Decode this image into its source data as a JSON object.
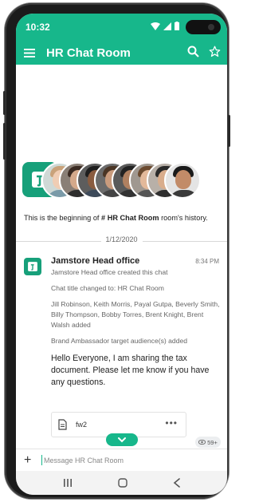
{
  "status_bar": {
    "time": "10:32"
  },
  "app_bar": {
    "title": "HR Chat Room"
  },
  "history": {
    "prefix": "This is the beginning of ",
    "room": "# HR Chat Room",
    "suffix": " room's history."
  },
  "date_divider": "1/12/2020",
  "message": {
    "sender": "Jamstore Head office",
    "time": "8:34 PM",
    "system_lines": [
      "Jamstore Head office created this chat",
      "Chat title changed to: HR Chat Room",
      "Jill Robinson, Keith Morris, Payal Gutpa, Beverly Smith, Billy Thompson, Bobby Torres, Brent Knight, Brent Walsh added",
      "Brand Ambassador target audience(s) added"
    ],
    "text": "Hello Everyone, I am sharing the tax document. Please let me know if you have any questions.",
    "attachment": {
      "name": "fw2",
      "menu": "•••"
    },
    "seen_count": "59+"
  },
  "composer": {
    "placeholder": "Message HR Chat Room"
  },
  "icons": {
    "menu": "menu-icon",
    "search": "search-icon",
    "star": "star-icon",
    "file": "file-icon",
    "chevron": "chevron-down-icon",
    "eye": "eye-icon",
    "plus": "plus-icon",
    "recents": "recents-icon",
    "home": "home-icon",
    "back": "back-icon"
  },
  "colors": {
    "accent": "#17b78b",
    "brand": "#17a07a"
  }
}
